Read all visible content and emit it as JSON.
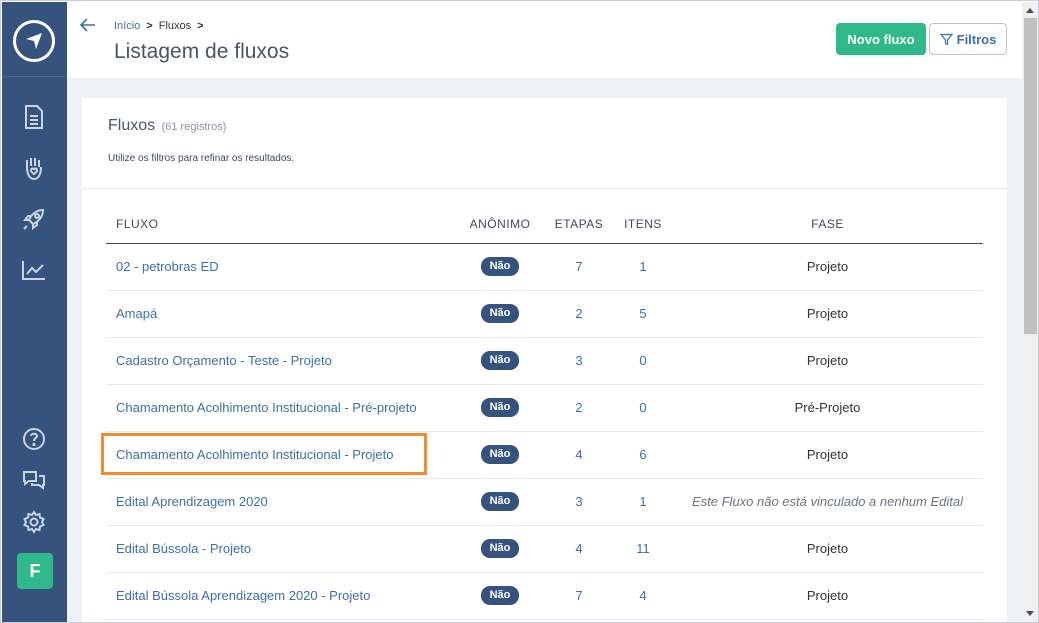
{
  "sidebar": {
    "icons": [
      "navigation-logo-icon",
      "document-icon",
      "hand-heart-icon",
      "rocket-icon",
      "chart-icon",
      "help-icon",
      "chat-icon",
      "settings-icon"
    ],
    "avatar_initial": "F",
    "colors": {
      "background": "#35537d",
      "avatar": "#2fb88a"
    }
  },
  "header": {
    "breadcrumb": {
      "home": "Início",
      "current": "Fluxos",
      "separator": ">"
    },
    "title": "Listagem de fluxos",
    "new_button": "Novo fluxo",
    "filter_button": "Filtros"
  },
  "card": {
    "title": "Fluxos",
    "count": "(61 registros)",
    "description": "Utilize os filtros para refinar os resultados."
  },
  "table": {
    "headers": {
      "fluxo": "FLUXO",
      "anonimo": "ANÔNIMO",
      "etapas": "ETAPAS",
      "itens": "ITENS",
      "fase": "FASE"
    },
    "rows": [
      {
        "fluxo": "02 - petrobras ED",
        "anonimo": "Não",
        "etapas": "7",
        "itens": "1",
        "fase": "Projeto"
      },
      {
        "fluxo": "Amapá",
        "anonimo": "Não",
        "etapas": "2",
        "itens": "5",
        "fase": "Projeto"
      },
      {
        "fluxo": "Cadastro Orçamento - Teste - Projeto",
        "anonimo": "Não",
        "etapas": "3",
        "itens": "0",
        "fase": "Projeto"
      },
      {
        "fluxo": "Chamamento Acolhimento Institucional - Pré-projeto",
        "anonimo": "Não",
        "etapas": "2",
        "itens": "0",
        "fase": "Pré-Projeto"
      },
      {
        "fluxo": "Chamamento Acolhimento Institucional - Projeto",
        "anonimo": "Não",
        "etapas": "4",
        "itens": "6",
        "fase": "Projeto"
      },
      {
        "fluxo": "Edital Aprendizagem 2020",
        "anonimo": "Não",
        "etapas": "3",
        "itens": "1",
        "fase": "Este Fluxo não está vinculado a nenhum Edital"
      },
      {
        "fluxo": "Edital Bússola - Projeto",
        "anonimo": "Não",
        "etapas": "4",
        "itens": "11",
        "fase": "Projeto"
      },
      {
        "fluxo": "Edital Bússola Aprendizagem 2020 - Projeto",
        "anonimo": "Não",
        "etapas": "7",
        "itens": "4",
        "fase": "Projeto"
      }
    ]
  },
  "colors": {
    "accent": "#2fb88a",
    "link": "#3f6ea8",
    "highlight": "#f28a2e"
  }
}
